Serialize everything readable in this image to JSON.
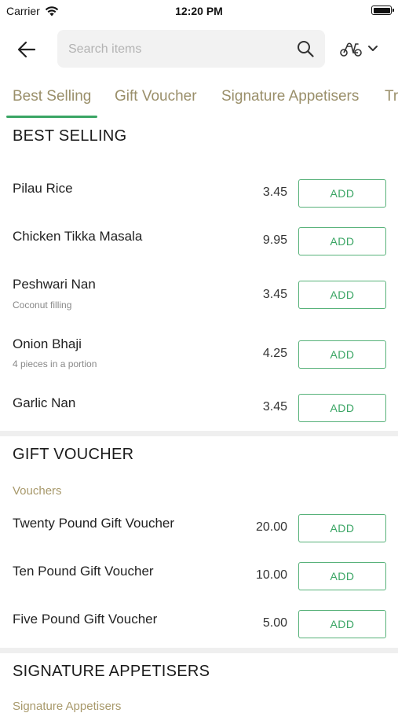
{
  "status_bar": {
    "carrier": "Carrier",
    "time": "12:20 PM"
  },
  "header": {
    "search_placeholder": "Search items"
  },
  "tabs": [
    {
      "label": "Best Selling"
    },
    {
      "label": "Gift Voucher"
    },
    {
      "label": "Signature Appetisers"
    },
    {
      "label": "Tr"
    }
  ],
  "sections": {
    "best_selling": {
      "title": "BEST SELLING",
      "items": [
        {
          "name": "Pilau Rice",
          "price": "3.45",
          "add_label": "ADD"
        },
        {
          "name": "Chicken Tikka Masala",
          "price": "9.95",
          "add_label": "ADD"
        },
        {
          "name": "Peshwari Nan",
          "description": "Coconut filling",
          "price": "3.45",
          "add_label": "ADD"
        },
        {
          "name": "Onion Bhaji",
          "description": "4 pieces in a portion",
          "price": "4.25",
          "add_label": "ADD"
        },
        {
          "name": "Garlic Nan",
          "price": "3.45",
          "add_label": "ADD"
        }
      ]
    },
    "gift_voucher": {
      "title": "GIFT VOUCHER",
      "subcategory": "Vouchers",
      "items": [
        {
          "name": "Twenty Pound Gift Voucher",
          "price": "20.00",
          "add_label": "ADD"
        },
        {
          "name": "Ten Pound Gift Voucher",
          "price": "10.00",
          "add_label": "ADD"
        },
        {
          "name": "Five Pound Gift Voucher",
          "price": "5.00",
          "add_label": "ADD"
        }
      ]
    },
    "signature_appetisers": {
      "title": "SIGNATURE APPETISERS",
      "subcategory": "Signature Appetisers"
    }
  },
  "colors": {
    "accent_green": "#3aa564",
    "tab_text": "#9a8f6a",
    "subcategory_text": "#a8996b"
  },
  "icons": {
    "back": "arrow-left-icon",
    "search": "search-icon",
    "mode": "scooter-icon",
    "mode_dropdown": "chevron-down-icon"
  }
}
